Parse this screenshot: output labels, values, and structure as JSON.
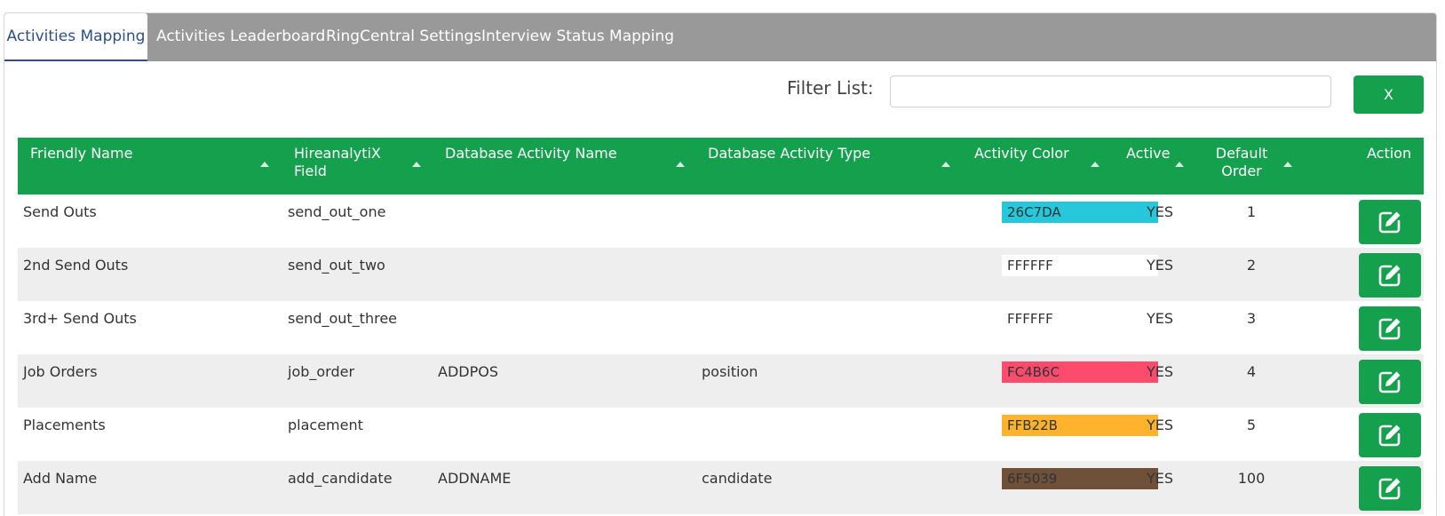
{
  "tabs": [
    {
      "label": "Activities Mapping",
      "active": true
    },
    {
      "label": "Activities Leaderboard",
      "active": false
    },
    {
      "label": "RingCentral Settings",
      "active": false
    },
    {
      "label": "Interview Status Mapping",
      "active": false
    }
  ],
  "filter": {
    "label": "Filter List:",
    "value": "",
    "placeholder": "",
    "clear_label": "X"
  },
  "table": {
    "headers": {
      "friendly_name": "Friendly Name",
      "field_line1": "HireanalytiX",
      "field_line2": "Field",
      "db_name": "Database Activity Name",
      "db_type": "Database Activity Type",
      "color": "Activity Color",
      "active": "Active",
      "order_line1": "Default",
      "order_line2": "Order",
      "action": "Action"
    },
    "rows": [
      {
        "friendly_name": "Send Outs",
        "field": "send_out_one",
        "db_name": "",
        "db_type": "",
        "color": "26C7DA",
        "active": "YES",
        "order": "1"
      },
      {
        "friendly_name": "2nd Send Outs",
        "field": "send_out_two",
        "db_name": "",
        "db_type": "",
        "color": "FFFFFF",
        "active": "YES",
        "order": "2"
      },
      {
        "friendly_name": "3rd+ Send Outs",
        "field": "send_out_three",
        "db_name": "",
        "db_type": "",
        "color": "FFFFFF",
        "active": "YES",
        "order": "3"
      },
      {
        "friendly_name": "Job Orders",
        "field": "job_order",
        "db_name": "ADDPOS",
        "db_type": "position",
        "color": "FC4B6C",
        "active": "YES",
        "order": "4"
      },
      {
        "friendly_name": "Placements",
        "field": "placement",
        "db_name": "",
        "db_type": "",
        "color": "FFB22B",
        "active": "YES",
        "order": "5"
      },
      {
        "friendly_name": "Add Name",
        "field": "add_candidate",
        "db_name": "ADDNAME",
        "db_type": "candidate",
        "color": "6F5039",
        "active": "YES",
        "order": "100"
      }
    ]
  },
  "colors": {
    "accent_green": "#14a04c",
    "tab_bar": "#999999",
    "active_tab_text": "#2b4f86",
    "row_alt": "#eeeeee"
  },
  "icons": {
    "edit": "pencil-square-icon",
    "sort": "sort-asc-icon"
  }
}
